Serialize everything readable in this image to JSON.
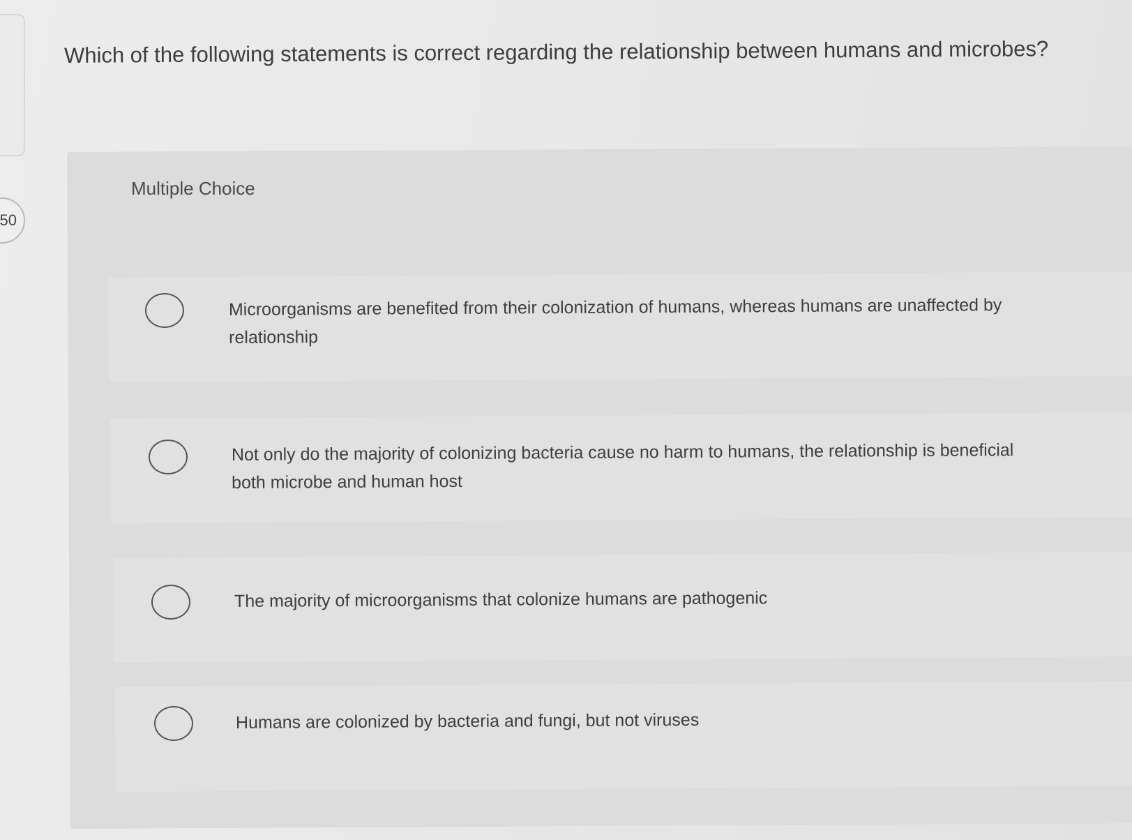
{
  "question_number": "50",
  "question": "Which of the following statements is correct regarding the relationship between humans and microbes?",
  "section_label": "Multiple Choice",
  "options": [
    {
      "line1": "Microorganisms are benefited from their colonization of humans, whereas humans are unaffected by",
      "line2": "relationship"
    },
    {
      "line1": "Not only do the majority of colonizing bacteria cause no harm to humans, the relationship is beneficial",
      "line2": "both microbe and human host"
    },
    {
      "line1": "The majority of microorganisms that colonize humans are pathogenic",
      "line2": ""
    },
    {
      "line1": "Humans are colonized by bacteria and fungi, but not viruses",
      "line2": ""
    }
  ]
}
